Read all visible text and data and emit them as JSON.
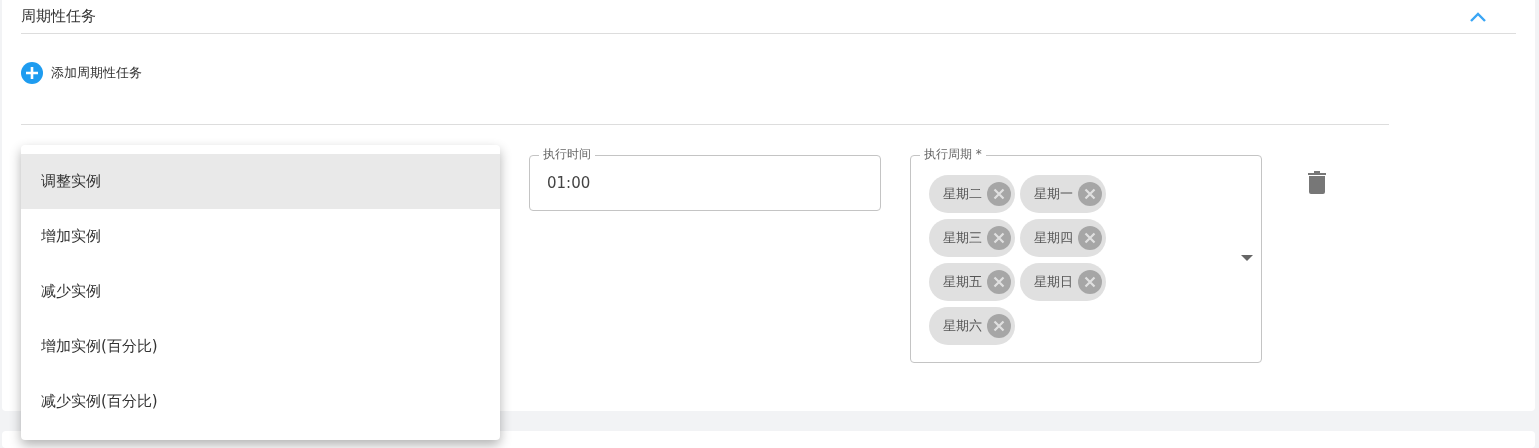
{
  "section": {
    "title": "周期性任务",
    "expanded": true
  },
  "add_button": {
    "label": "添加周期性任务"
  },
  "task": {
    "time_field": {
      "label": "执行时间",
      "value": "01:00"
    },
    "period_field": {
      "label": "执行周期 *",
      "chips": [
        "星期二",
        "星期一",
        "星期三",
        "星期四",
        "星期五",
        "星期日",
        "星期六"
      ]
    }
  },
  "action_menu": {
    "open": true,
    "options": [
      {
        "label": "调整实例",
        "selected": true
      },
      {
        "label": "增加实例",
        "selected": false
      },
      {
        "label": "减少实例",
        "selected": false
      },
      {
        "label": "增加实例(百分比)",
        "selected": false
      },
      {
        "label": "减少实例(百分比)",
        "selected": false
      }
    ]
  }
}
